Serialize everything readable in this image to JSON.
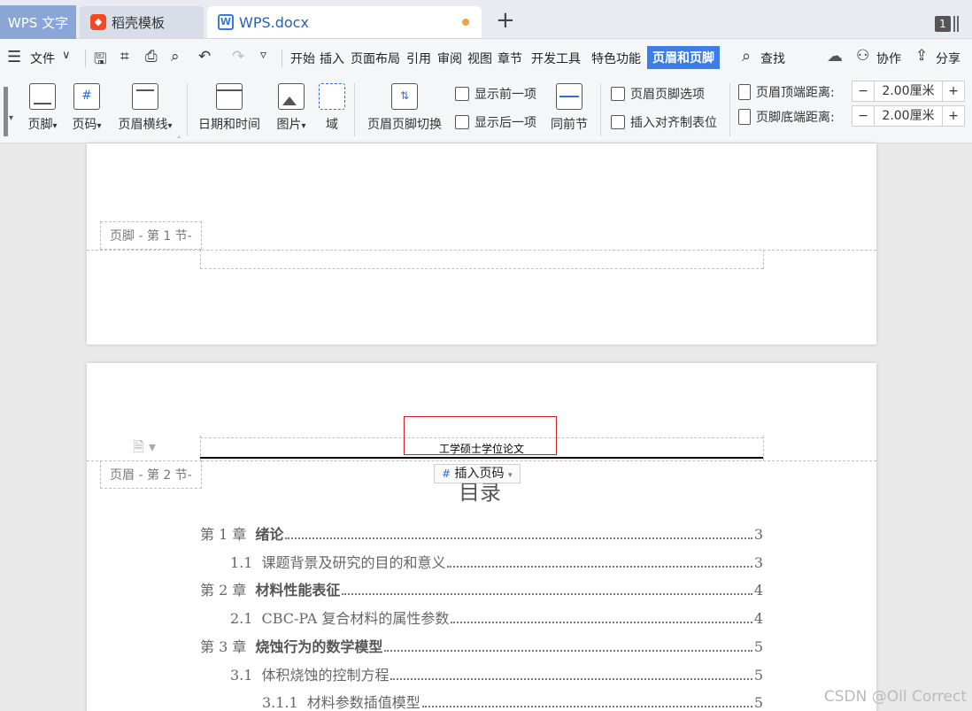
{
  "tabs": {
    "app": "WPS 文字",
    "template": "稻壳模板",
    "document": "WPS.docx",
    "badge": "1"
  },
  "menu": {
    "file": "文件",
    "items": [
      "开始",
      "插入",
      "页面布局",
      "引用",
      "审阅",
      "视图",
      "章节",
      "开发工具",
      "特色功能"
    ],
    "active": "页眉和页脚",
    "search": "查找",
    "collab": "协作",
    "share": "分享"
  },
  "ribbon": {
    "footer": "页脚",
    "page_number": "页码",
    "header_line": "页眉横线",
    "datetime": "日期和时间",
    "picture": "图片",
    "field": "域",
    "switch": "页眉页脚切换",
    "show_prev": "显示前一项",
    "show_next": "显示后一项",
    "same_as_prev": "同前节",
    "options": "页眉页脚选项",
    "insert_tab": "插入对齐制表位",
    "top_distance_label": "页眉顶端距离:",
    "top_distance_value": "2.00厘米",
    "bottom_distance_label": "页脚底端距离:",
    "bottom_distance_value": "2.00厘米",
    "minus": "−",
    "plus": "+"
  },
  "document": {
    "footer_label": "页脚 - 第 1 节-",
    "header_label": "页眉 - 第 2 节-",
    "header_text": "工学硕士学位论文",
    "insert_page_number": "插入页码",
    "toc_title": "目录",
    "toc": [
      {
        "num": "第 1 章",
        "title": "绪论",
        "page": "3",
        "level": 1
      },
      {
        "num": "1.1",
        "title": "课题背景及研究的目的和意义",
        "page": "3",
        "level": 2
      },
      {
        "num": "第 2 章",
        "title": "材料性能表征",
        "page": "4",
        "level": 1
      },
      {
        "num": "2.1",
        "title": "CBC-PA 复合材料的属性参数",
        "page": "4",
        "level": 2
      },
      {
        "num": "第 3 章",
        "title": "烧蚀行为的数学模型",
        "page": "5",
        "level": 1
      },
      {
        "num": "3.1",
        "title": "体积烧蚀的控制方程",
        "page": "5",
        "level": 2
      },
      {
        "num": "3.1.1",
        "title": "材料参数插值模型",
        "page": "5",
        "level": 3
      }
    ]
  },
  "watermark": "CSDN @Oll Correct"
}
